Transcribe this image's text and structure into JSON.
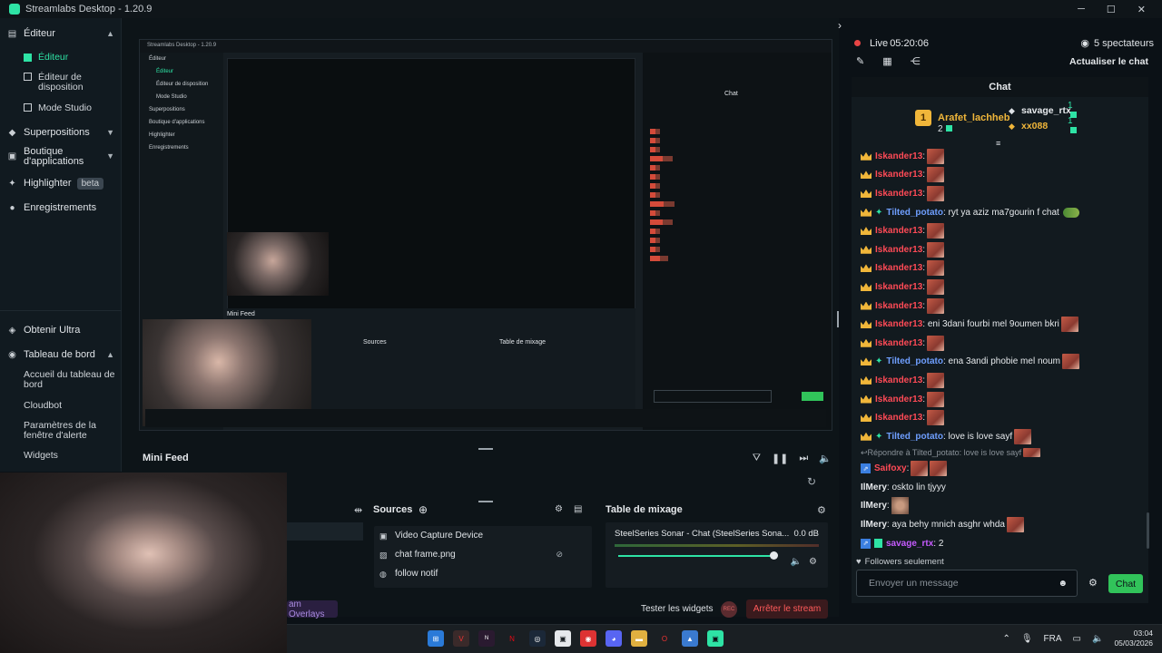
{
  "window": {
    "title": "Streamlabs Desktop - 1.20.9"
  },
  "sidebar": {
    "editor": "Éditeur",
    "editor_active": "Éditeur",
    "layout_editor": "Éditeur de disposition",
    "studio_mode": "Mode Studio",
    "overlays": "Superpositions",
    "app_store": "Boutique d'applications",
    "highlighter": "Highlighter",
    "highlighter_badge": "beta",
    "recordings": "Enregistrements",
    "ultra": "Obtenir Ultra",
    "dashboard": "Tableau de bord",
    "dashboard_home": "Accueil du tableau de bord",
    "cloudbot": "Cloudbot",
    "alert_settings": "Paramètres de la fenêtre d'alerte",
    "widgets": "Widgets"
  },
  "feed": {
    "title": "Mini Feed"
  },
  "sources": {
    "title": "Sources",
    "items": [
      "Video Capture Device",
      "chat frame.png",
      "follow notif"
    ]
  },
  "mixer": {
    "title": "Table de mixage",
    "device": "SteelSeries Sonar - Chat (SteelSeries Sona...",
    "db": "0.0 dB",
    "volume": 0.98
  },
  "footer": {
    "overlays_btn": "am Overlays",
    "test_widgets": "Tester les widgets",
    "rec": "REC",
    "stop": "Arrêter le stream"
  },
  "stream": {
    "live_label": "Live",
    "live_time": "05:20:06",
    "viewers": "5 spectateurs",
    "refresh_chat": "Actualiser le chat"
  },
  "chat": {
    "header": "Chat",
    "leader1": {
      "rank": "1",
      "name": "Arafet_lachheb",
      "points": "2"
    },
    "leader2": {
      "name": "savage_rtx",
      "count": "1"
    },
    "leader3": {
      "name": "xx088",
      "count": "1"
    },
    "messages": [
      {
        "user": "Iskander13",
        "text": ":"
      },
      {
        "user": "Iskander13",
        "text": ":"
      },
      {
        "user": "Iskander13",
        "text": ":"
      },
      {
        "user": "Tilted_potato",
        "text": ": ryt ya aziz ma7gourin f chat"
      },
      {
        "user": "Iskander13",
        "text": ":"
      },
      {
        "user": "Iskander13",
        "text": ":"
      },
      {
        "user": "Iskander13",
        "text": ":"
      },
      {
        "user": "Iskander13",
        "text": ":"
      },
      {
        "user": "Iskander13",
        "text": ":"
      },
      {
        "user": "Iskander13",
        "text": ": eni 3dani fourbi mel 9oumen bkri"
      },
      {
        "user": "Iskander13",
        "text": ":"
      },
      {
        "user": "Tilted_potato",
        "text": ": ena 3andi phobie mel noum"
      },
      {
        "user": "Iskander13",
        "text": ":"
      },
      {
        "user": "Iskander13",
        "text": ":"
      },
      {
        "user": "Iskander13",
        "text": ":"
      },
      {
        "user": "Tilted_potato",
        "text": ": love is love sayf"
      }
    ],
    "reply": "Répondre à Tilted_potato: love is love sayf",
    "messages2": [
      {
        "user": "Saifoxy",
        "text": ":"
      },
      {
        "user": "IlMery",
        "text": ": oskto lin tjyyy"
      },
      {
        "user": "IlMery",
        "text": ":"
      },
      {
        "user": "IlMery",
        "text": ": aya behy mnich asghr whda"
      },
      {
        "user": "savage_rtx",
        "text": ": 2"
      }
    ],
    "followers_only": "Followers seulement",
    "input_placeholder": "Envoyer un message",
    "send": "Chat"
  },
  "taskbar": {
    "lang": "FRA",
    "time": "03:04",
    "date": "05/03/2026"
  },
  "nested": {
    "title": "Streamlabs Desktop - 1.20.9",
    "feed": "Mini Feed",
    "sources": "Sources",
    "mixer": "Table de mixage",
    "chat": "Chat"
  }
}
